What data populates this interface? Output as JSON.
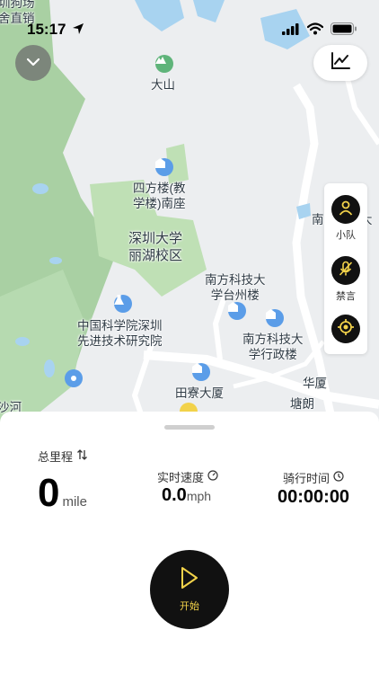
{
  "status_bar": {
    "time": "15:17"
  },
  "map": {
    "labels": {
      "top_left_1": "圳狗场",
      "top_left_2": "舍直销",
      "mountain": "大山",
      "bldg_teaching": "四方楼(教\n学楼)南座",
      "university": "深圳大学\n丽湖校区",
      "sustech_north": "南方科技大\n学台州楼",
      "cas": "中国科学院深圳\n先进技术研究院",
      "sustech_admin": "南方科技大\n学行政楼",
      "tianliao": "田寮大厦",
      "huaxia": "华厦",
      "tanglang": "塘朗",
      "south_edge": "南方科技大",
      "sha_river": "沙河"
    }
  },
  "side_panel": {
    "team_label": "小队",
    "mute_label": "禁言"
  },
  "stats": {
    "distance_title": "总里程",
    "distance_value": "0",
    "distance_unit": "mile",
    "speed_title": "实时速度",
    "speed_value": "0.0",
    "speed_unit": "mph",
    "duration_title": "骑行时间",
    "duration_value": "00:00:00"
  },
  "start_button": {
    "label": "开始"
  },
  "colors": {
    "map_green": "#a9d0a3",
    "map_water": "#a8d3f0",
    "accent_yellow": "#f2d24a",
    "button_dark": "#111111"
  }
}
